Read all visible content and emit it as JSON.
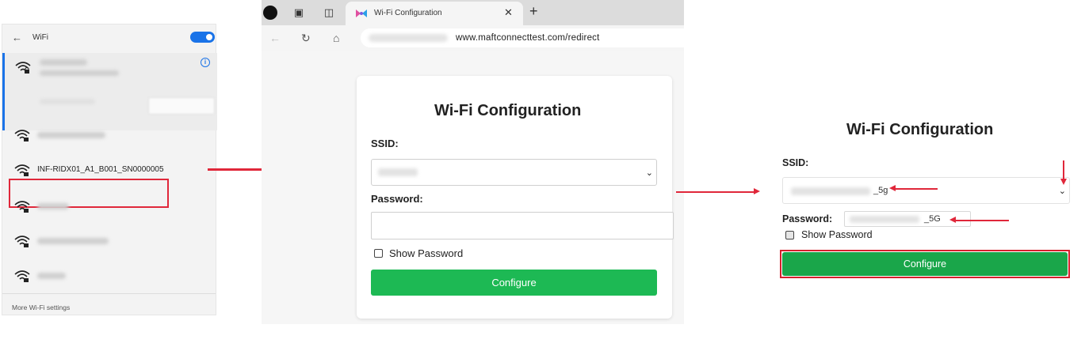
{
  "wifi_panel": {
    "back_icon": "back-arrow-icon",
    "title": "WiFi",
    "toggle_on": true,
    "accent": "#1a73e8",
    "networks": [
      {
        "label": ""
      },
      {
        "label": ""
      },
      {
        "label": "INF-RIDX01_A1_B001_SN0000005",
        "highlighted": true
      },
      {
        "label": ""
      },
      {
        "label": ""
      },
      {
        "label": ""
      }
    ],
    "footer": "More Wi-Fi settings"
  },
  "browser": {
    "tab_title": "Wi-Fi Configuration",
    "tab_close": "✕",
    "new_tab": "+",
    "url": "www.maftconnecttest.com/redirect"
  },
  "config_form": {
    "title": "Wi-Fi Configuration",
    "ssid_label": "SSID:",
    "password_label": "Password:",
    "show_password": "Show Password",
    "button": "Configure",
    "button_color": "#1db954"
  },
  "config_form_filled": {
    "title": "Wi-Fi Configuration",
    "ssid_label": "SSID:",
    "ssid_value_suffix": "_5g",
    "password_label": "Password:",
    "password_value_suffix": "_5G",
    "show_password": "Show Password",
    "button": "Configure",
    "button_color": "#1aa64a",
    "annotation_color": "#e0273a"
  }
}
